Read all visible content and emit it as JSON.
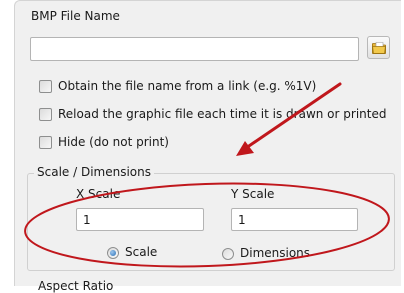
{
  "bmp_file_name": {
    "label": "BMP File Name",
    "value": "",
    "browse_icon": "folder-icon"
  },
  "options": [
    {
      "label": "Obtain the file name from a link (e.g. %1V)",
      "checked": false
    },
    {
      "label": "Reload the graphic file each time it is drawn or printed",
      "checked": false
    },
    {
      "label": "Hide (do not print)",
      "checked": false
    }
  ],
  "scale_dimensions": {
    "legend": "Scale / Dimensions",
    "x_scale": {
      "label": "X Scale",
      "value": "1"
    },
    "y_scale": {
      "label": "Y Scale",
      "value": "1"
    },
    "mode_options": [
      {
        "label": "Scale",
        "selected": true
      },
      {
        "label": "Dimensions",
        "selected": false
      }
    ]
  },
  "aspect_ratio": {
    "label": "Aspect Ratio"
  },
  "annotation": {
    "color": "#c0171c",
    "shapes": [
      "arrow",
      "ellipse"
    ]
  }
}
